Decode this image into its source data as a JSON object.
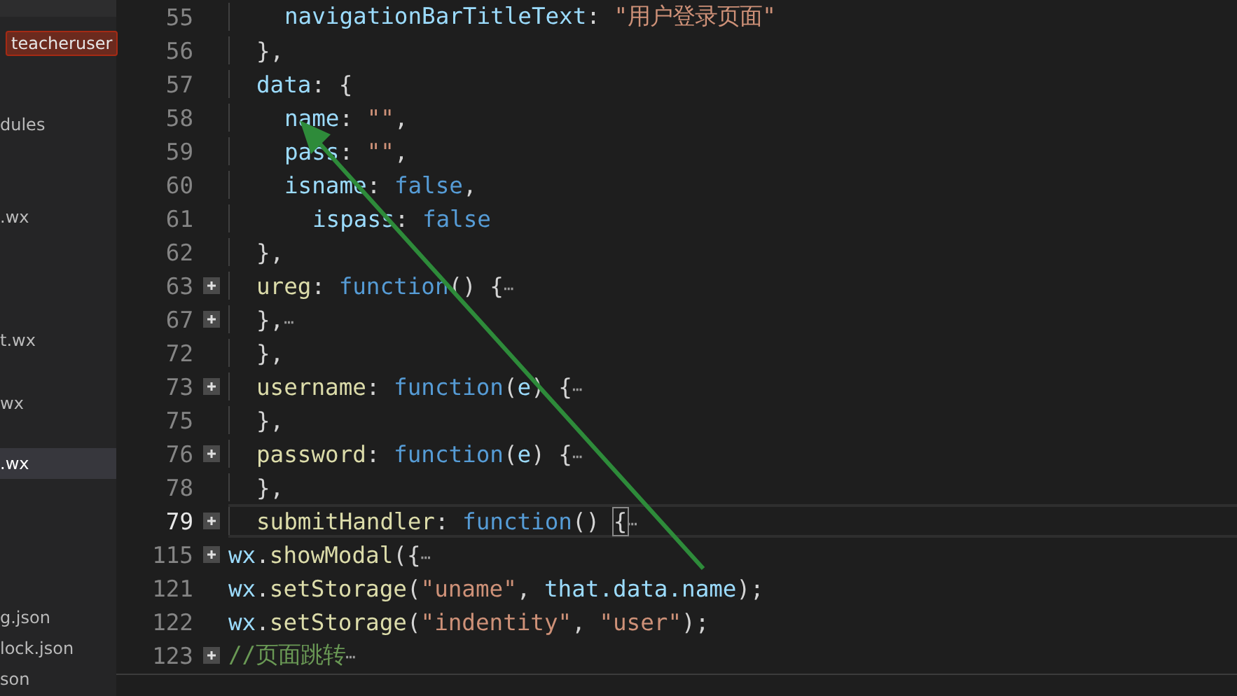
{
  "sidebar": {
    "items": [
      {
        "label": "teacheruser",
        "kind": "badge",
        "selected": false
      },
      {
        "label": "dules",
        "kind": "file",
        "selected": false
      },
      {
        "label": ".wx",
        "kind": "file",
        "selected": false
      },
      {
        "label": "t.wx",
        "kind": "file",
        "selected": false
      },
      {
        "label": "wx",
        "kind": "file",
        "selected": false
      },
      {
        "label": ".wx",
        "kind": "file",
        "selected": true
      },
      {
        "label": "g.json",
        "kind": "file",
        "selected": false
      },
      {
        "label": "lock.json",
        "kind": "file",
        "selected": false
      },
      {
        "label": "son",
        "kind": "file",
        "selected": false
      }
    ]
  },
  "editor": {
    "lines": [
      {
        "children": [
          {
            "children": [
              {
                "number": "55",
                "fold": false,
                "current": false,
                "tokens": [
                  {
                    "kind": "key",
                    "text": "navigationBarTitleText"
                  },
                  {
                    "kind": "punct",
                    "text": ": "
                  },
                  {
                    "kind": "string",
                    "text": "\"用户登录页面\""
                  }
                ]
              }
            ]
          },
          {
            "number": "56",
            "fold": false,
            "current": false,
            "tokens": [
              {
                "kind": "punct",
                "text": "},"
              }
            ]
          },
          {
            "number": "57",
            "fold": false,
            "current": false,
            "tokens": [
              {
                "kind": "key",
                "text": "data"
              },
              {
                "kind": "punct",
                "text": ": {"
              }
            ],
            "children": [
              {
                "number": "58",
                "fold": false,
                "current": false,
                "tokens": [
                  {
                    "kind": "key",
                    "text": "name"
                  },
                  {
                    "kind": "punct",
                    "text": ": "
                  },
                  {
                    "kind": "string",
                    "text": "\"\""
                  },
                  {
                    "kind": "punct",
                    "text": ","
                  }
                ]
              },
              {
                "number": "59",
                "fold": false,
                "current": false,
                "tokens": [
                  {
                    "kind": "key",
                    "text": "pass"
                  },
                  {
                    "kind": "punct",
                    "text": ": "
                  },
                  {
                    "kind": "string",
                    "text": "\"\""
                  },
                  {
                    "kind": "punct",
                    "text": ","
                  }
                ]
              },
              {
                "number": "60",
                "fold": false,
                "current": false,
                "tokens": [
                  {
                    "kind": "key",
                    "text": "isname"
                  },
                  {
                    "kind": "punct",
                    "text": ": "
                  },
                  {
                    "kind": "keyword",
                    "text": "false"
                  },
                  {
                    "kind": "punct",
                    "text": ","
                  }
                ]
              },
              {
                "children": [
                  {
                    "number": "61",
                    "fold": false,
                    "current": false,
                    "tokens": [
                      {
                        "kind": "key",
                        "text": "ispass"
                      },
                      {
                        "kind": "punct",
                        "text": ": "
                      },
                      {
                        "kind": "keyword",
                        "text": "false"
                      }
                    ]
                  }
                ]
              }
            ]
          },
          {
            "number": "62",
            "fold": false,
            "current": false,
            "tokens": [
              {
                "kind": "punct",
                "text": "},"
              }
            ]
          },
          {
            "number": "63",
            "fold": true,
            "current": false,
            "tokens": [
              {
                "kind": "func",
                "text": "ureg"
              },
              {
                "kind": "punct",
                "text": ": "
              },
              {
                "kind": "keyword",
                "text": "function"
              },
              {
                "kind": "punct",
                "text": "() {"
              },
              {
                "kind": "ellipsis",
                "text": "⋯"
              }
            ]
          },
          {
            "number": "67",
            "fold": true,
            "current": false,
            "tokens": [
              {
                "kind": "punct",
                "text": "},"
              },
              {
                "kind": "ellipsis",
                "text": "⋯"
              }
            ]
          },
          {
            "number": "72",
            "fold": false,
            "current": false,
            "tokens": [
              {
                "kind": "punct",
                "text": "},"
              }
            ]
          },
          {
            "number": "73",
            "fold": true,
            "current": false,
            "tokens": [
              {
                "kind": "func",
                "text": "username"
              },
              {
                "kind": "punct",
                "text": ": "
              },
              {
                "kind": "keyword",
                "text": "function"
              },
              {
                "kind": "punct",
                "text": "("
              },
              {
                "kind": "key",
                "text": "e"
              },
              {
                "kind": "punct",
                "text": ") {"
              },
              {
                "kind": "ellipsis",
                "text": "⋯"
              }
            ]
          },
          {
            "number": "75",
            "fold": false,
            "current": false,
            "tokens": [
              {
                "kind": "punct",
                "text": "},"
              }
            ]
          },
          {
            "number": "76",
            "fold": true,
            "current": false,
            "tokens": [
              {
                "kind": "func",
                "text": "password"
              },
              {
                "kind": "punct",
                "text": ": "
              },
              {
                "kind": "keyword",
                "text": "function"
              },
              {
                "kind": "punct",
                "text": "("
              },
              {
                "kind": "key",
                "text": "e"
              },
              {
                "kind": "punct",
                "text": ") {"
              },
              {
                "kind": "ellipsis",
                "text": "⋯"
              }
            ]
          },
          {
            "number": "78",
            "fold": false,
            "current": false,
            "tokens": [
              {
                "kind": "punct",
                "text": "},"
              }
            ]
          },
          {
            "number": "79",
            "fold": true,
            "current": true,
            "tokens": [
              {
                "kind": "func",
                "text": "submitHandler"
              },
              {
                "kind": "punct",
                "text": ": "
              },
              {
                "kind": "keyword",
                "text": "function"
              },
              {
                "kind": "punct",
                "text": "() "
              },
              {
                "kind": "bracket",
                "text": "{"
              },
              {
                "kind": "ellipsis",
                "text": "⋯"
              }
            ]
          }
        ]
      },
      {
        "number": "115",
        "fold": true,
        "current": false,
        "tokens": [
          {
            "kind": "key",
            "text": "wx"
          },
          {
            "kind": "punct",
            "text": "."
          },
          {
            "kind": "func",
            "text": "showModal"
          },
          {
            "kind": "punct",
            "text": "({"
          },
          {
            "kind": "ellipsis",
            "text": "⋯"
          }
        ]
      },
      {
        "number": "121",
        "fold": false,
        "current": false,
        "tokens": [
          {
            "kind": "key",
            "text": "wx"
          },
          {
            "kind": "punct",
            "text": "."
          },
          {
            "kind": "func",
            "text": "setStorage"
          },
          {
            "kind": "punct",
            "text": "("
          },
          {
            "kind": "string",
            "text": "\"uname\""
          },
          {
            "kind": "punct",
            "text": ", "
          },
          {
            "kind": "key",
            "text": "that.data.name"
          },
          {
            "kind": "punct",
            "text": ");"
          }
        ]
      },
      {
        "number": "122",
        "fold": false,
        "current": false,
        "tokens": [
          {
            "kind": "key",
            "text": "wx"
          },
          {
            "kind": "punct",
            "text": "."
          },
          {
            "kind": "func",
            "text": "setStorage"
          },
          {
            "kind": "punct",
            "text": "("
          },
          {
            "kind": "string",
            "text": "\"indentity\""
          },
          {
            "kind": "punct",
            "text": ", "
          },
          {
            "kind": "string",
            "text": "\"user\""
          },
          {
            "kind": "punct",
            "text": ");"
          }
        ]
      },
      {
        "number": "123",
        "fold": true,
        "current": false,
        "tokens": [
          {
            "kind": "comment",
            "text": "//页面跳转"
          },
          {
            "kind": "ellipsis",
            "text": "⋯"
          }
        ]
      }
    ]
  }
}
